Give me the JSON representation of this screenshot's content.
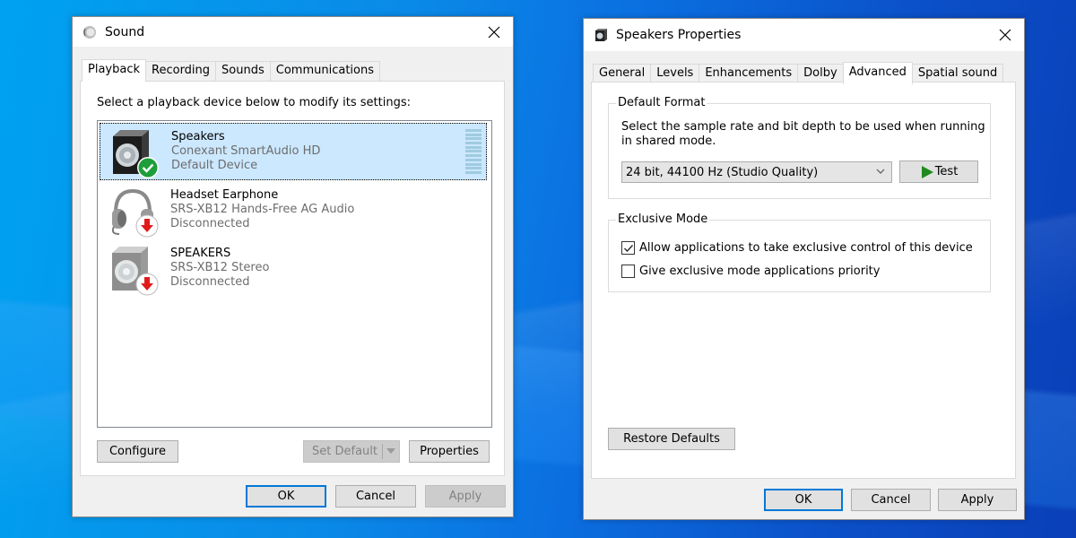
{
  "sound_window": {
    "title": "Sound",
    "icon": "speaker-icon",
    "tabs": [
      {
        "label": "Playback",
        "active": true
      },
      {
        "label": "Recording",
        "active": false
      },
      {
        "label": "Sounds",
        "active": false
      },
      {
        "label": "Communications",
        "active": false
      }
    ],
    "instruction": "Select a playback device below to modify its settings:",
    "devices": [
      {
        "name": "Speakers",
        "description": "Conexant SmartAudio HD",
        "status": "Default Device",
        "icon": "speaker-icon",
        "badge": "check-badge-icon",
        "selected": true
      },
      {
        "name": "Headset Earphone",
        "description": "SRS-XB12 Hands-Free AG Audio",
        "status": "Disconnected",
        "icon": "headset-icon",
        "badge": "disconnected-arrow-icon",
        "selected": false
      },
      {
        "name": "SPEAKERS",
        "description": "SRS-XB12 Stereo",
        "status": "Disconnected",
        "icon": "speaker-icon",
        "badge": "disconnected-arrow-icon",
        "selected": false
      }
    ],
    "buttons": {
      "configure": "Configure",
      "set_default": "Set Default",
      "properties": "Properties",
      "ok": "OK",
      "cancel": "Cancel",
      "apply": "Apply"
    }
  },
  "properties_window": {
    "title": "Speakers Properties",
    "icon": "speaker-icon",
    "tabs": [
      {
        "label": "General",
        "active": false
      },
      {
        "label": "Levels",
        "active": false
      },
      {
        "label": "Enhancements",
        "active": false
      },
      {
        "label": "Dolby",
        "active": false
      },
      {
        "label": "Advanced",
        "active": true
      },
      {
        "label": "Spatial sound",
        "active": false
      }
    ],
    "default_format": {
      "legend": "Default Format",
      "description_line1": "Select the sample rate and bit depth to be used when running",
      "description_line2": "in shared mode.",
      "selected_format": "24 bit, 44100 Hz (Studio Quality)",
      "test_label": "Test"
    },
    "exclusive_mode": {
      "legend": "Exclusive Mode",
      "options": [
        {
          "label": "Allow applications to take exclusive control of this device",
          "checked": true
        },
        {
          "label": "Give exclusive mode applications priority",
          "checked": false
        }
      ]
    },
    "buttons": {
      "restore_defaults": "Restore Defaults",
      "ok": "OK",
      "cancel": "Cancel",
      "apply": "Apply"
    }
  },
  "colors": {
    "selection": "#cce8ff",
    "default_button_border": "#0078d7",
    "test_arrow": "#1f8a1f",
    "check_green": "#1e9e3a",
    "disconnect_red": "#e01b1b"
  }
}
